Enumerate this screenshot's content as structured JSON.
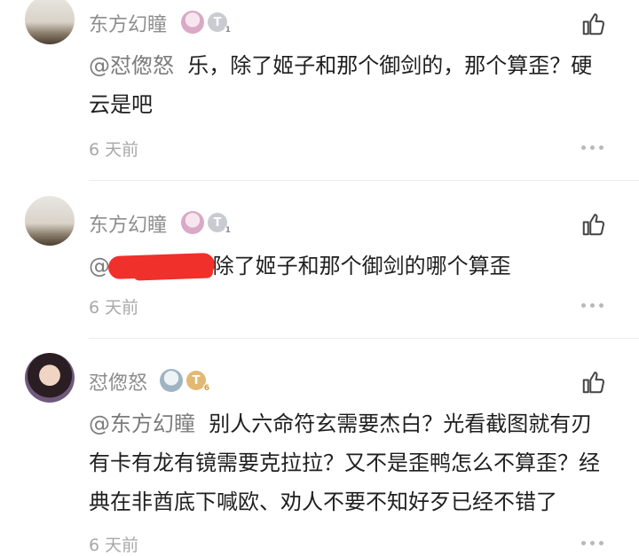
{
  "comments": [
    {
      "username": "东方幻瞳",
      "badge_level": "1",
      "mention": "@怼偬怒",
      "text": "乐，除了姬子和那个御剑的，那个算歪？硬云是吧",
      "time": "6 天前"
    },
    {
      "username": "东方幻瞳",
      "badge_level": "1",
      "mention": "@",
      "text": "除了姬子和那个御剑的哪个算歪",
      "time": "6 天前"
    },
    {
      "username": "怼偬怒",
      "badge_level": "6",
      "mention": "@东方幻瞳",
      "text": "别人六命符玄需要杰白？光看截图就有刃有卡有龙有镜需要克拉拉？又不是歪鸭怎么不算歪？经典在非酋底下喊欧、劝人不要不知好歹已经不错了",
      "time": "6 天前"
    }
  ],
  "colors": {
    "username": "#8e8e8e",
    "mention": "#7c7c7c",
    "text": "#1f1f1f",
    "time": "#a8a8a8",
    "redaction": "#f0302a"
  },
  "icons": {
    "like": "thumbs-up-icon",
    "more": "more-dots-icon",
    "badge_girl": "anime-girl-badge-icon",
    "badge_level": "level-badge-icon"
  }
}
